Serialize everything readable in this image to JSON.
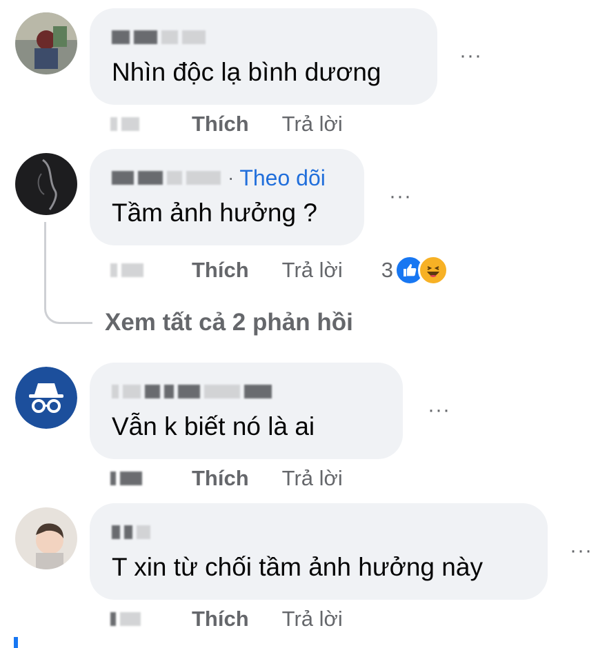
{
  "comments": [
    {
      "text": "Nhìn độc lạ bình dương",
      "like_label": "Thích",
      "reply_label": "Trả lời"
    },
    {
      "follow_label": "Theo dõi",
      "separator": "·",
      "text": "Tầm ảnh hưởng ?",
      "like_label": "Thích",
      "reply_label": "Trả lời",
      "reaction_count": "3",
      "reactions": [
        "like-icon",
        "haha-icon"
      ]
    },
    {
      "text": "Vẫn k biết nó là ai",
      "like_label": "Thích",
      "reply_label": "Trả lời"
    },
    {
      "text": "T xin từ chối tầm ảnh hưởng này",
      "like_label": "Thích",
      "reply_label": "Trả lời"
    }
  ],
  "thread": {
    "view_replies_label": "Xem tất cả 2 phản hồi"
  },
  "more_options_glyph": "···",
  "colors": {
    "bubble": "#f0f2f5",
    "secondary_text": "#65676b",
    "follow_link": "#216fdb",
    "like_blue": "#1877f2",
    "haha_yellow": "#f7b125",
    "anon_avatar": "#1c4f9c"
  }
}
